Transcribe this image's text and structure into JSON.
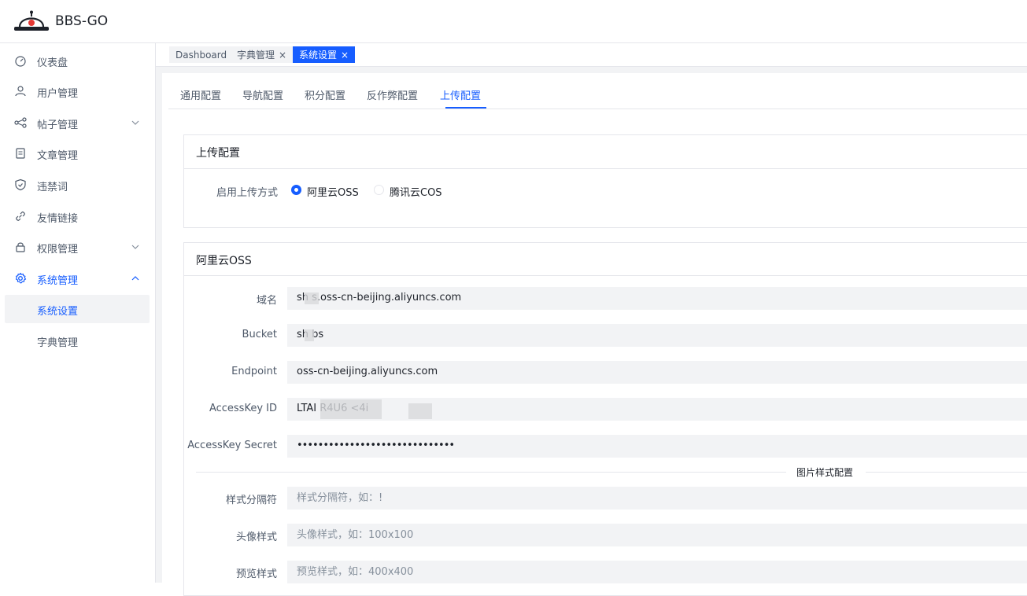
{
  "app": {
    "brand": "BBS-GO"
  },
  "sidebar": {
    "items": [
      {
        "label": "仪表盘",
        "icon": "dashboard-icon"
      },
      {
        "label": "用户管理",
        "icon": "user-icon"
      },
      {
        "label": "帖子管理",
        "icon": "share-icon"
      },
      {
        "label": "文章管理",
        "icon": "file-icon"
      },
      {
        "label": "违禁词",
        "icon": "shield-icon"
      },
      {
        "label": "友情链接",
        "icon": "link-icon"
      },
      {
        "label": "权限管理",
        "icon": "lock-icon"
      },
      {
        "label": "系统管理",
        "icon": "settings-icon"
      }
    ],
    "sub_items": [
      {
        "label": "系统设置"
      },
      {
        "label": "字典管理"
      }
    ]
  },
  "tags": [
    {
      "label": "Dashboard"
    },
    {
      "label": "字典管理",
      "close": "×"
    },
    {
      "label": "系统设置",
      "close": "×"
    }
  ],
  "tabs": [
    {
      "label": "通用配置"
    },
    {
      "label": "导航配置"
    },
    {
      "label": "积分配置"
    },
    {
      "label": "反作弊配置"
    },
    {
      "label": "上传配置"
    }
  ],
  "upload_card": {
    "title": "上传配置",
    "method_label": "启用上传方式",
    "options": [
      {
        "label": "阿里云OSS",
        "checked": true
      },
      {
        "label": "腾讯云COS",
        "checked": false
      }
    ]
  },
  "oss_card": {
    "title": "阿里云OSS",
    "fields": {
      "domain": {
        "label": "域名",
        "value": "sh    s.oss-cn-beijing.aliyuncs.com"
      },
      "bucket": {
        "label": "Bucket",
        "value": "sh    bs"
      },
      "endpoint": {
        "label": "Endpoint",
        "value": "oss-cn-beijing.aliyuncs.com"
      },
      "access_key_id": {
        "label": "AccessKey ID",
        "value": "LTAI                    R4U6        <4i"
      },
      "access_key_secret": {
        "label": "AccessKey Secret",
        "value": "••••••••••••••••••••••••••••••"
      }
    },
    "divider_text": "图片样式配置",
    "style_fields": {
      "separator": {
        "label": "样式分隔符",
        "placeholder": "样式分隔符，如：!"
      },
      "avatar": {
        "label": "头像样式",
        "placeholder": "头像样式，如：100x100"
      },
      "preview": {
        "label": "预览样式",
        "placeholder": "预览样式，如：400x400"
      }
    }
  },
  "colors": {
    "primary": "#165dff",
    "input_bg": "#f2f3f5",
    "border": "#e5e6eb"
  }
}
